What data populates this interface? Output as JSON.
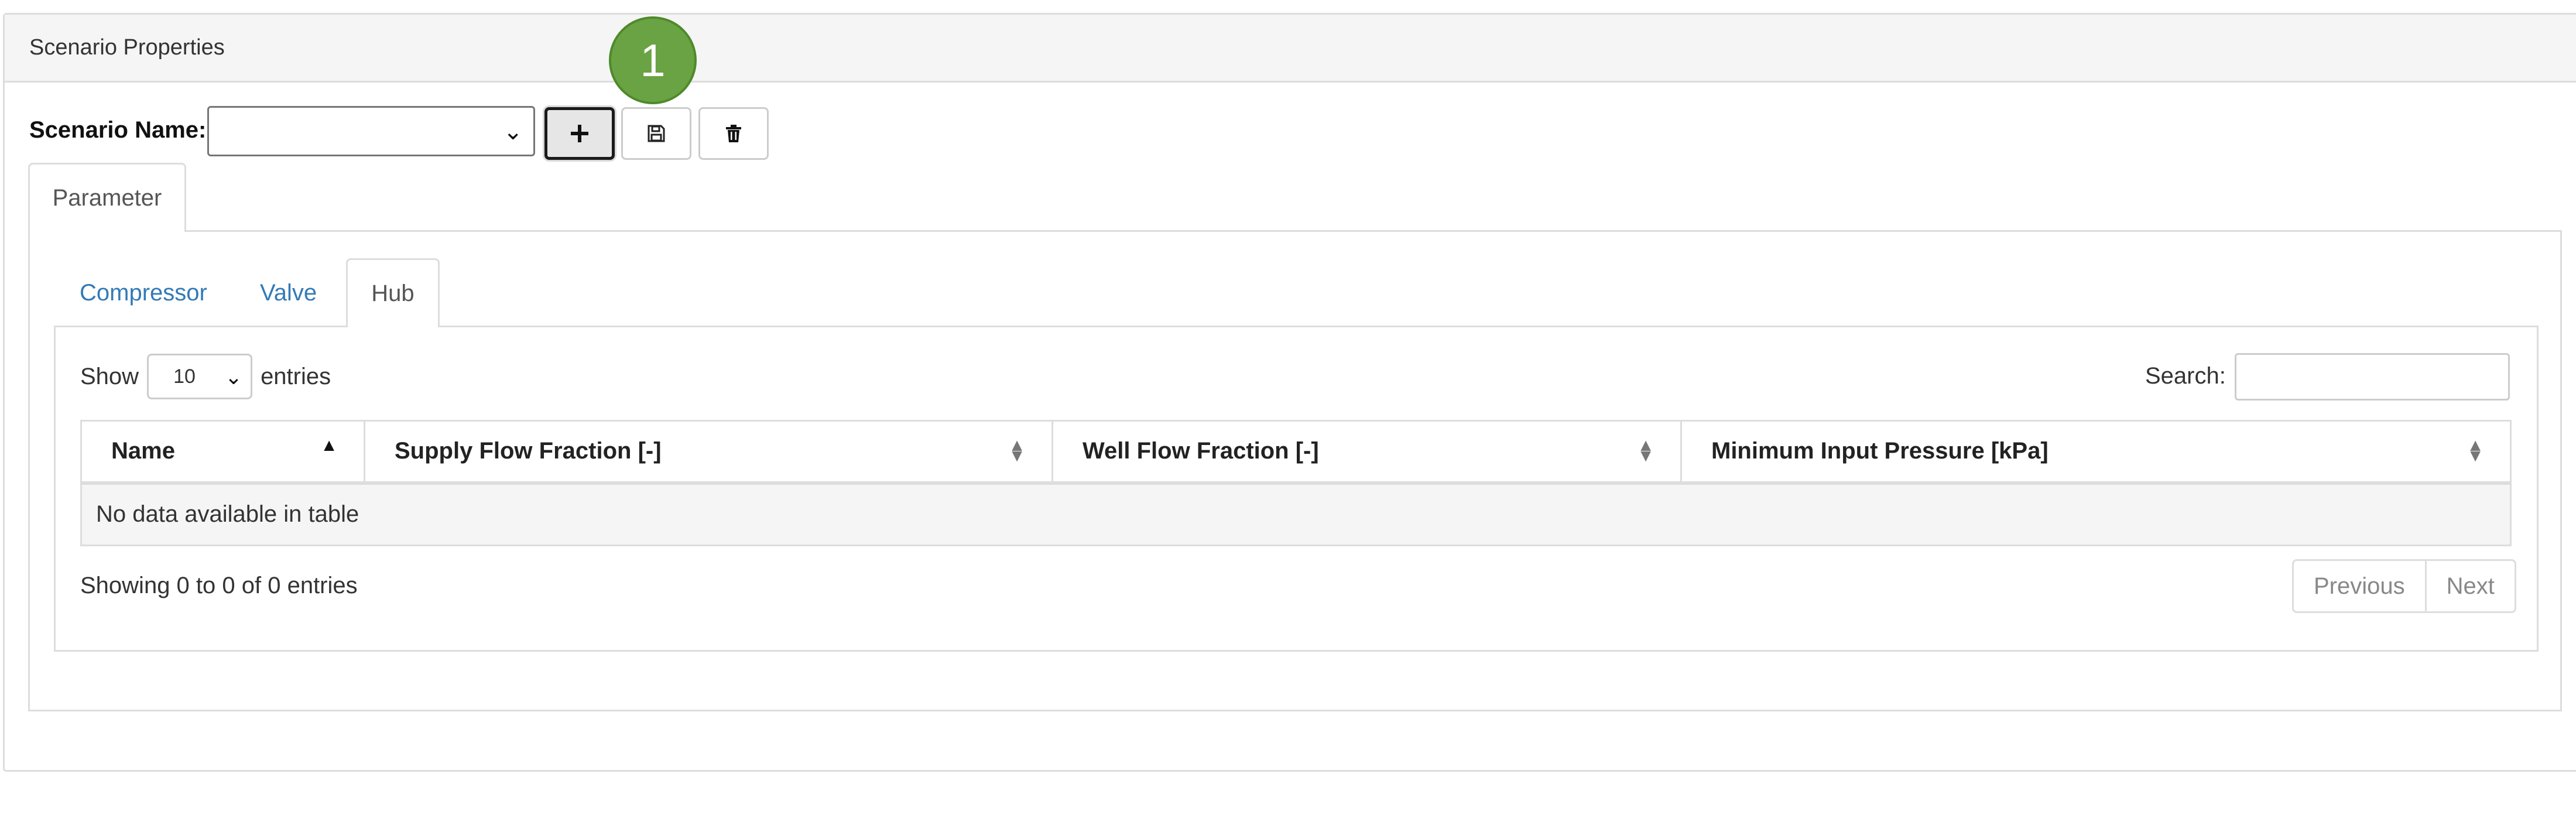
{
  "panel": {
    "title": "Scenario Properties"
  },
  "marker": {
    "label": "1",
    "color": "#6aa343"
  },
  "scenario": {
    "name_label": "Scenario Name:",
    "selected_value": "",
    "buttons": {
      "add_icon": "plus-icon",
      "save_icon": "floppy-disk-icon",
      "delete_icon": "trash-icon"
    }
  },
  "tabs": {
    "main": [
      "Parameter"
    ],
    "sub": [
      "Compressor",
      "Valve",
      "Hub"
    ],
    "active_sub": "Hub"
  },
  "length": {
    "show_label": "Show",
    "value": "10",
    "entries_label": "entries"
  },
  "search": {
    "label": "Search:",
    "value": ""
  },
  "table": {
    "columns": [
      "Name",
      "Supply Flow Fraction [-]",
      "Well Flow Fraction [-]",
      "Minimum Input Pressure [kPa]"
    ],
    "empty_message": "No data available in table"
  },
  "info": "Showing 0 to 0 of 0 entries",
  "pagination": {
    "previous": "Previous",
    "next": "Next"
  },
  "colors": {
    "link": "#337ab7",
    "border": "#dddddd",
    "heading_bg": "#f5f5f5"
  }
}
